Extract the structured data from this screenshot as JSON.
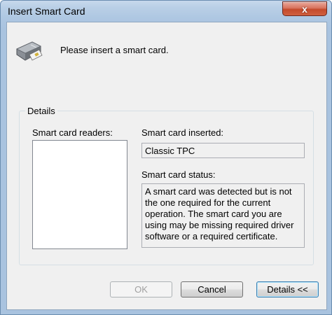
{
  "window": {
    "title": "Insert Smart Card",
    "close_glyph": "x"
  },
  "main": {
    "icon": "smart-card-reader-icon",
    "message": "Please insert a smart card."
  },
  "details": {
    "group_label": "Details",
    "readers_label": "Smart card readers:",
    "readers_items": [],
    "inserted_label": "Smart card inserted:",
    "inserted_value": "Classic TPC",
    "status_label": "Smart card status:",
    "status_value": "A smart card was detected but is not the one required for the current operation. The smart card you are using may be missing required driver software or a required certificate."
  },
  "buttons": {
    "ok_label": "OK",
    "cancel_label": "Cancel",
    "details_label": "Details <<"
  },
  "colors": {
    "close_button": "#c44a2c",
    "dialog_background": "#f0f0f0",
    "title_bar": "#b9cfe6"
  }
}
